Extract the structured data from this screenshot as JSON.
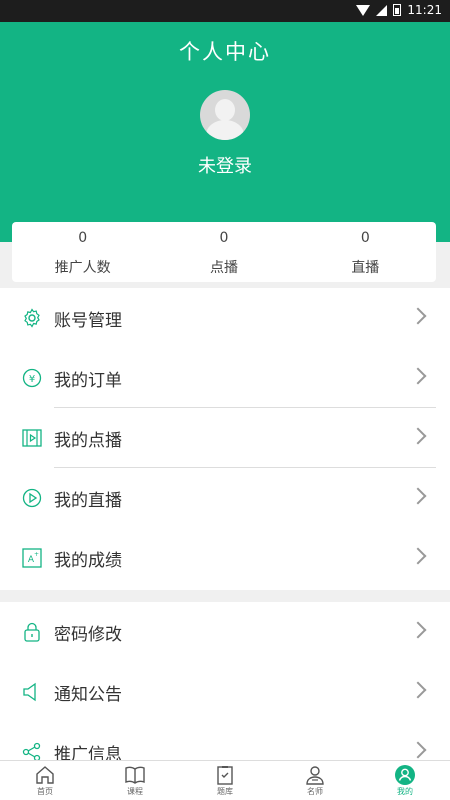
{
  "status_bar": {
    "time": "11:21"
  },
  "header": {
    "title": "个人中心",
    "login_text": "未登录"
  },
  "stats": [
    {
      "value": "0",
      "label": "推广人数"
    },
    {
      "value": "0",
      "label": "点播"
    },
    {
      "value": "0",
      "label": "直播"
    }
  ],
  "menu1": [
    {
      "label": "账号管理",
      "icon": "gear-icon"
    },
    {
      "label": "我的订单",
      "icon": "yen-icon"
    },
    {
      "label": "我的点播",
      "icon": "video-icon"
    },
    {
      "label": "我的直播",
      "icon": "play-circle-icon"
    },
    {
      "label": "我的成绩",
      "icon": "grade-icon"
    }
  ],
  "menu2": [
    {
      "label": "密码修改",
      "icon": "lock-icon"
    },
    {
      "label": "通知公告",
      "icon": "speaker-icon"
    },
    {
      "label": "推广信息",
      "icon": "share-icon"
    }
  ],
  "tabbar": [
    {
      "label": "首页",
      "icon": "home-icon"
    },
    {
      "label": "课程",
      "icon": "book-icon"
    },
    {
      "label": "题库",
      "icon": "checklist-icon"
    },
    {
      "label": "名师",
      "icon": "teacher-icon"
    },
    {
      "label": "我的",
      "icon": "user-icon",
      "active": true
    }
  ],
  "colors": {
    "accent": "#13b484"
  }
}
